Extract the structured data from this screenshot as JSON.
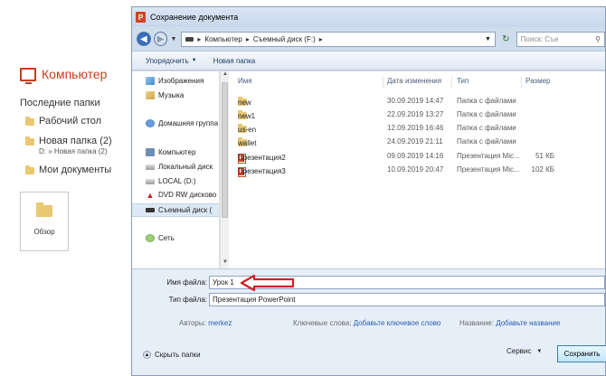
{
  "backstage": {
    "title": "Компьютер",
    "recent_label": "Последние папки",
    "items": [
      {
        "label": "Рабочий стол",
        "sub": ""
      },
      {
        "label": "Новая папка (2)",
        "sub": "D: » Новая папка (2)"
      },
      {
        "label": "Мои документы",
        "sub": ""
      }
    ],
    "browse_label": "Обзор"
  },
  "dialog": {
    "title": "Сохранение документа",
    "path": [
      "Компьютер",
      "Съемный диск (F:)"
    ],
    "search_placeholder": "Поиск: Съе",
    "toolbar": {
      "organize": "Упорядочить",
      "new_folder": "Новая папка"
    },
    "nav": [
      {
        "label": "Изображения",
        "icon": "pictures-icon"
      },
      {
        "label": "Музыка",
        "icon": "music-icon"
      },
      {
        "label": "Домашняя группа",
        "icon": "homegroup-icon"
      },
      {
        "label": "Компьютер",
        "icon": "computer-icon"
      },
      {
        "label": "Локальный диск",
        "icon": "drive-icon"
      },
      {
        "label": "LOCAL (D:)",
        "icon": "drive-icon"
      },
      {
        "label": "DVD RW дисково",
        "icon": "dvd-icon"
      },
      {
        "label": "Съемный диск (",
        "icon": "usb-drive-icon"
      },
      {
        "label": "Сеть",
        "icon": "network-icon"
      }
    ],
    "columns": {
      "name": "Имя",
      "date": "Дата изменения",
      "type": "Тип",
      "size": "Размер"
    },
    "files": [
      {
        "name": "new",
        "date": "30.09.2019 14:47",
        "type": "Папка с файлами",
        "size": "",
        "kind": "folder"
      },
      {
        "name": "new1",
        "date": "22.09.2019 13:27",
        "type": "Папка с файлами",
        "size": "",
        "kind": "folder"
      },
      {
        "name": "us-en",
        "date": "12.09.2019 16:46",
        "type": "Папка с файлами",
        "size": "",
        "kind": "folder"
      },
      {
        "name": "wallet",
        "date": "24.09.2019 21:11",
        "type": "Папка с файлами",
        "size": "",
        "kind": "folder"
      },
      {
        "name": "Презентация2",
        "date": "09.09.2019 14:16",
        "type": "Презентация Mic...",
        "size": "51 КБ",
        "kind": "ppt"
      },
      {
        "name": "Презентация3",
        "date": "10.09.2019 20:47",
        "type": "Презентация Mic...",
        "size": "102 КБ",
        "kind": "ppt"
      }
    ],
    "filename_label": "Имя файла:",
    "filename_value": "Урок 1",
    "filetype_label": "Тип файла:",
    "filetype_value": "Презентация PowerPoint",
    "authors_label": "Авторы:",
    "authors_value": "merkez",
    "keywords_label": "Ключевые слова:",
    "keywords_value": "Добавьте ключевое слово",
    "name_label": "Название:",
    "name_value": "Добавьте название",
    "hide_folders": "Скрыть папки",
    "service": "Сервис",
    "save": "Сохранить"
  },
  "colors": {
    "accent": "#c43e1c",
    "arrow": "#d21f1f",
    "link": "#2b5fb0"
  }
}
